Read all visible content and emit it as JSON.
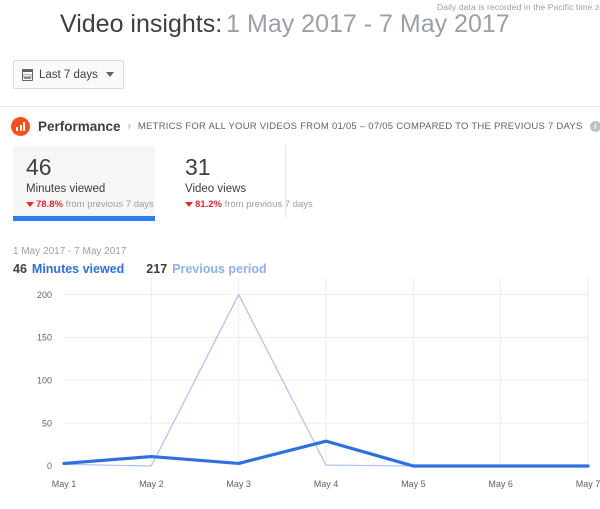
{
  "notice": "Daily data is recorded in the Pacific time zo",
  "header": {
    "title": "Video insights:",
    "date_range": "1 May 2017 - 7 May 2017"
  },
  "date_picker": {
    "label": "Last 7 days",
    "icon": "calendar-icon",
    "caret": "chevron-down-icon"
  },
  "performance": {
    "icon": "bar-chart-badge-icon",
    "title": "Performance",
    "separator": "›",
    "subtitle": "METRICS FOR ALL YOUR VIDEOS FROM 01/05 – 07/05 COMPARED TO THE PREVIOUS 7 DAYS",
    "info_icon": "info-icon",
    "info_glyph": "i"
  },
  "cards": [
    {
      "value": "46",
      "label": "Minutes viewed",
      "delta_pct": "78.8%",
      "delta_suffix": "from previous 7 days",
      "direction": "down",
      "selected": true
    },
    {
      "value": "31",
      "label": "Video views",
      "delta_pct": "81.2%",
      "delta_suffix": "from previous 7 days",
      "direction": "down",
      "selected": false
    }
  ],
  "legend": {
    "range": "1 May 2017 - 7 May 2017",
    "series": [
      {
        "value": "46",
        "name": "Minutes viewed",
        "color": "#2f6fe0"
      },
      {
        "value": "217",
        "name": "Previous period",
        "color": "#8fb0ee"
      }
    ]
  },
  "colors": {
    "accent_blue": "#2f7df6",
    "primary_line": "#2f6fe0",
    "secondary_line": "#a8c2f2",
    "badge_orange": "#f4511e",
    "negative_red": "#ea2a2a"
  },
  "chart_data": {
    "type": "line",
    "title": "",
    "subtitle": "1 May 2017 - 7 May 2017",
    "xlabel": "",
    "ylabel": "",
    "categories": [
      "May 1",
      "May 2",
      "May 3",
      "May 4",
      "May 5",
      "May 6",
      "May 7"
    ],
    "yticks": [
      0,
      50,
      100,
      150,
      200
    ],
    "ylim": [
      0,
      210
    ],
    "grid": true,
    "legend_position": "top-left",
    "series": [
      {
        "name": "Minutes viewed",
        "color": "#2f6fe0",
        "total": 46,
        "values": [
          3,
          11,
          3,
          29,
          0,
          0,
          0
        ]
      },
      {
        "name": "Previous period",
        "color": "#a8c2f2",
        "total": 217,
        "values": [
          2,
          0,
          200,
          1,
          0,
          0,
          1
        ]
      }
    ]
  }
}
